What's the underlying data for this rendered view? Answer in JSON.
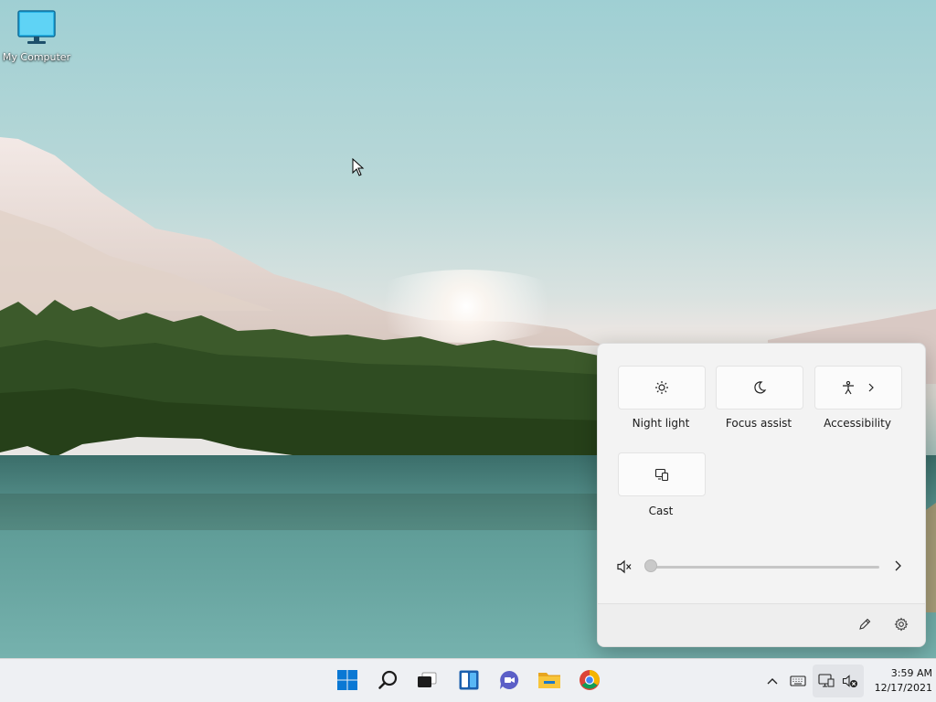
{
  "desktop": {
    "icons": [
      {
        "label": "My Computer",
        "icon": "monitor-icon"
      }
    ]
  },
  "quick_settings": {
    "tiles": [
      {
        "label": "Night light",
        "icon": "brightness-icon"
      },
      {
        "label": "Focus assist",
        "icon": "moon-icon"
      },
      {
        "label": "Accessibility",
        "icon": "accessibility-icon"
      },
      {
        "label": "Cast",
        "icon": "cast-icon"
      }
    ],
    "volume": {
      "level": 0,
      "muted": true,
      "icon": "speaker-muted-icon"
    },
    "footer": {
      "edit_icon": "pencil-icon",
      "settings_icon": "gear-icon"
    }
  },
  "taskbar": {
    "apps": [
      {
        "name": "start",
        "icon": "windows-logo-icon"
      },
      {
        "name": "search",
        "icon": "search-icon"
      },
      {
        "name": "task-view",
        "icon": "task-view-icon"
      },
      {
        "name": "widgets",
        "icon": "widgets-icon"
      },
      {
        "name": "chat",
        "icon": "chat-icon"
      },
      {
        "name": "file-explorer",
        "icon": "folder-icon"
      },
      {
        "name": "chrome",
        "icon": "chrome-icon"
      }
    ],
    "tray": {
      "icons": [
        "chevron-up-icon",
        "keyboard-icon",
        "network-icon",
        "speaker-muted-icon"
      ],
      "time": "3:59 AM",
      "date": "12/17/2021"
    }
  },
  "colors": {
    "taskbar_bg": "#eef0f3",
    "panel_bg": "#f3f3f3",
    "accent_blue": "#0a78d4",
    "chat_purple": "#5b5fc7",
    "folder_yellow": "#f8c53a"
  }
}
